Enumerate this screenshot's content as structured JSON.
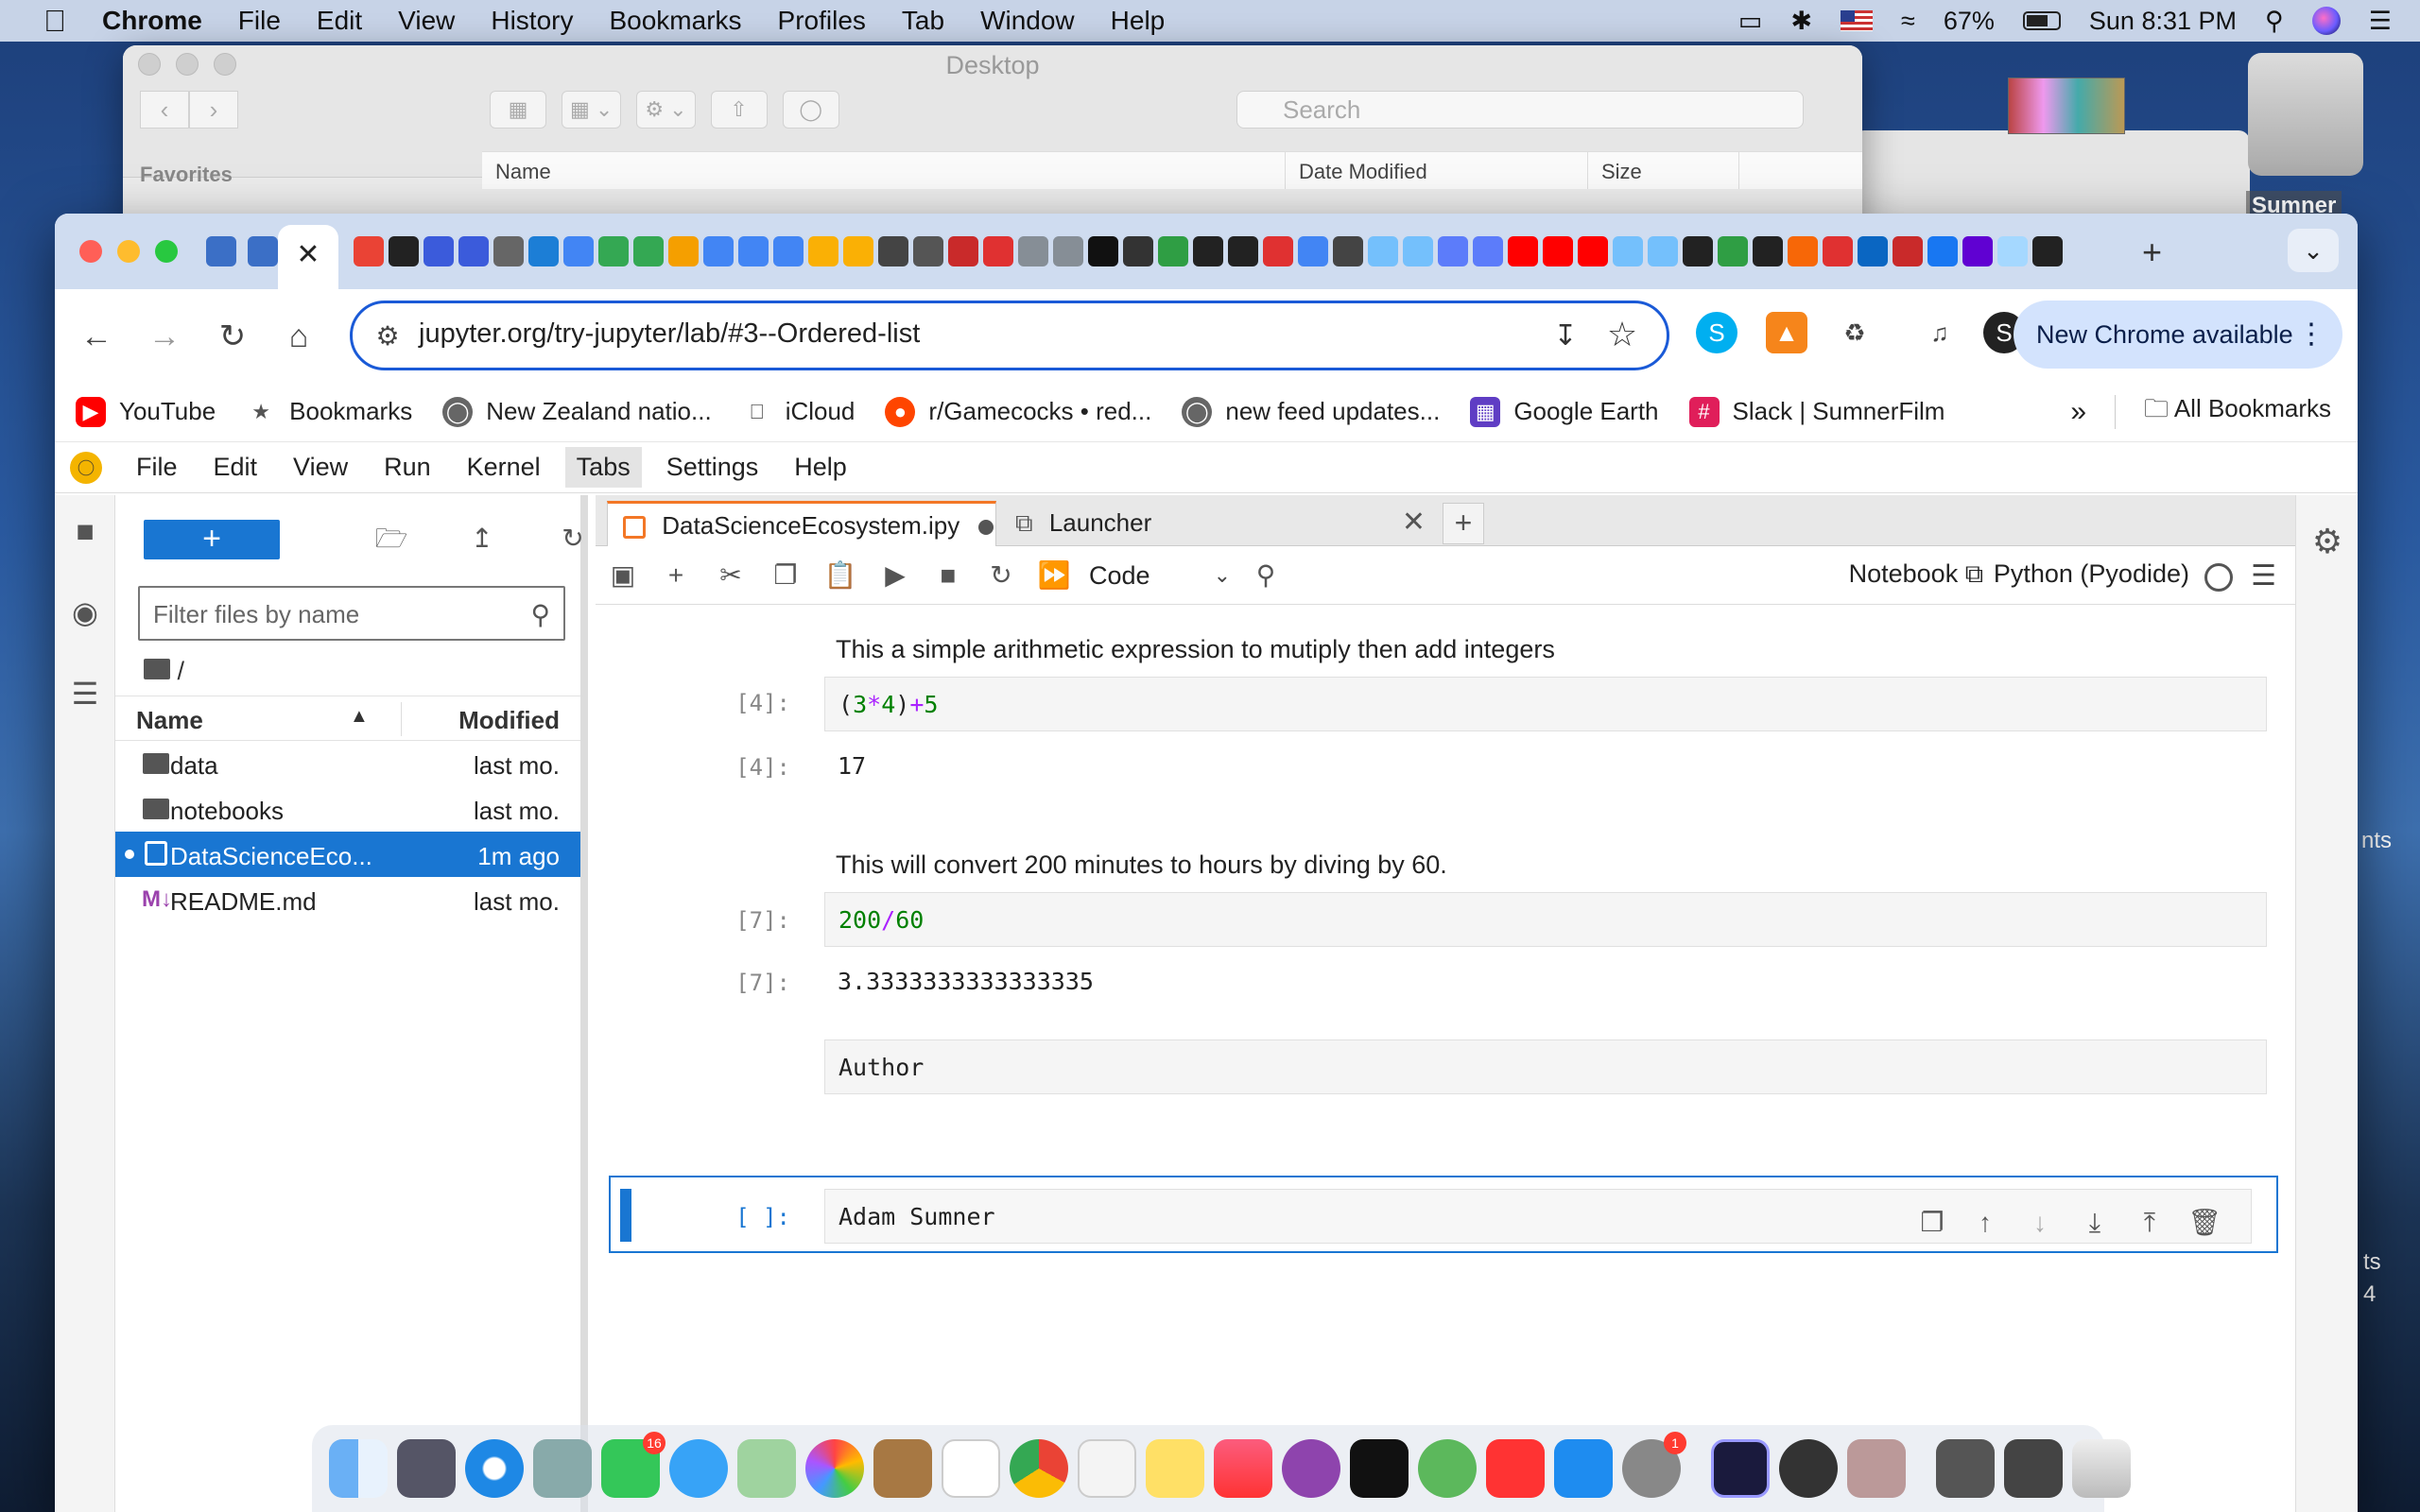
{
  "menubar": {
    "items": [
      "Chrome",
      "File",
      "Edit",
      "View",
      "History",
      "Bookmarks",
      "Profiles",
      "Tab",
      "Window",
      "Help"
    ],
    "battery": "67%",
    "clock": "Sun 8:31 PM"
  },
  "finder": {
    "title": "Desktop",
    "search_placeholder": "Search",
    "sidebar_heading": "Favorites",
    "columns": [
      "Name",
      "Date Modified",
      "Size"
    ]
  },
  "desktop": {
    "drive_label": "Sumner",
    "fragment_1": "nts",
    "fragment_2": "ts",
    "fragment_3": "4"
  },
  "browser": {
    "active_tab_icon": "close-icon",
    "url": "jupyter.org/try-jupyter/lab/#3--Ordered-list",
    "update_button": "New Chrome available",
    "bookmarks": [
      {
        "label": "YouTube",
        "icon": "youtube-icon",
        "color": "#ff0000"
      },
      {
        "label": "Bookmarks",
        "icon": "star-icon",
        "color": "#555555"
      },
      {
        "label": "New Zealand natio...",
        "icon": "globe-icon",
        "color": "#555555"
      },
      {
        "label": "iCloud",
        "icon": "apple-icon",
        "color": "#555555"
      },
      {
        "label": "r/Gamecocks • red...",
        "icon": "reddit-icon",
        "color": "#ff4500"
      },
      {
        "label": "new feed updates...",
        "icon": "globe-icon",
        "color": "#555555"
      },
      {
        "label": "Google Earth",
        "icon": "google-earth-icon",
        "color": "#5f3dc4"
      },
      {
        "label": "Slack | SumnerFilm",
        "icon": "slack-icon",
        "color": "#e01e5a"
      }
    ],
    "all_bookmarks": "All Bookmarks"
  },
  "jupyter": {
    "menu": [
      "File",
      "Edit",
      "View",
      "Run",
      "Kernel",
      "Tabs",
      "Settings",
      "Help"
    ],
    "filebrowser": {
      "filter_placeholder": "Filter files by name",
      "path": "/",
      "col_name": "Name",
      "col_modified": "Modified",
      "rows": [
        {
          "name": "data",
          "modified": "last mo.",
          "type": "folder"
        },
        {
          "name": "notebooks",
          "modified": "last mo.",
          "type": "folder"
        },
        {
          "name": "DataScienceEco...",
          "modified": "1m ago",
          "type": "notebook"
        },
        {
          "name": "README.md",
          "modified": "last mo.",
          "type": "markdown"
        }
      ]
    },
    "tabs": [
      {
        "label": "DataScienceEcosystem.ipy"
      },
      {
        "label": "Launcher"
      }
    ],
    "toolbar": {
      "cell_type": "Code",
      "notebook_link": "Notebook",
      "kernel": "Python (Pyodide)"
    },
    "cells": {
      "md1": "This a simple arithmetic expression to mutiply then add integers",
      "in4_prompt": "[4]:",
      "out4_prompt": "[4]:",
      "out4": "17",
      "md2": "This will convert 200 minutes to hours by diving by 60.",
      "in7_prompt": "[7]:",
      "out7_prompt": "[7]:",
      "out7": "3.3333333333333335",
      "author_cell": "Author",
      "active_prompt": "[ ]:",
      "active_text": "Adam Sumner"
    }
  },
  "colors": {
    "jupyter_blue": "#1976d2",
    "jupyter_orange": "#f37726",
    "chrome_blue": "#1a5ad7"
  }
}
